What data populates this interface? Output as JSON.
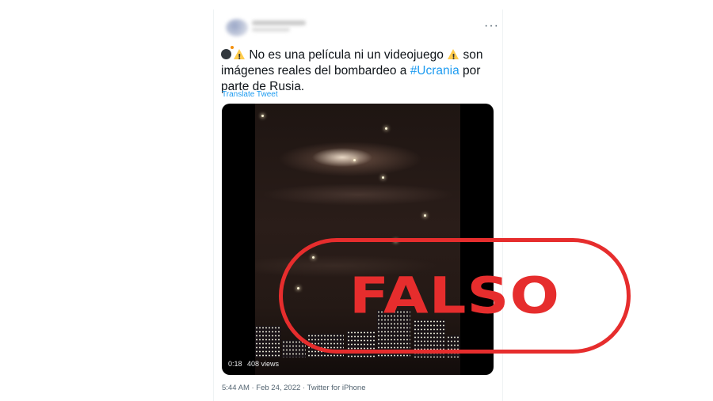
{
  "tweet": {
    "translate_label": "Translate Tweet",
    "text_part1": "No es una película ni un videojuego",
    "text_part2": "son imágenes reales del bombardeo a",
    "hashtag": "#Ucrania",
    "text_part3": "por parte de Rusia.",
    "more_icon": "more-horizontal-icon"
  },
  "video": {
    "duration": "0:18",
    "views": "408 views"
  },
  "meta": {
    "timestamp": "5:44 AM · Feb 24, 2022 · Twitter for iPhone"
  },
  "stamp": {
    "text": "FALSO",
    "color": "#e62d2d"
  },
  "colors": {
    "link": "#1d9bf0",
    "text": "#0f1419",
    "muted": "#536471"
  }
}
